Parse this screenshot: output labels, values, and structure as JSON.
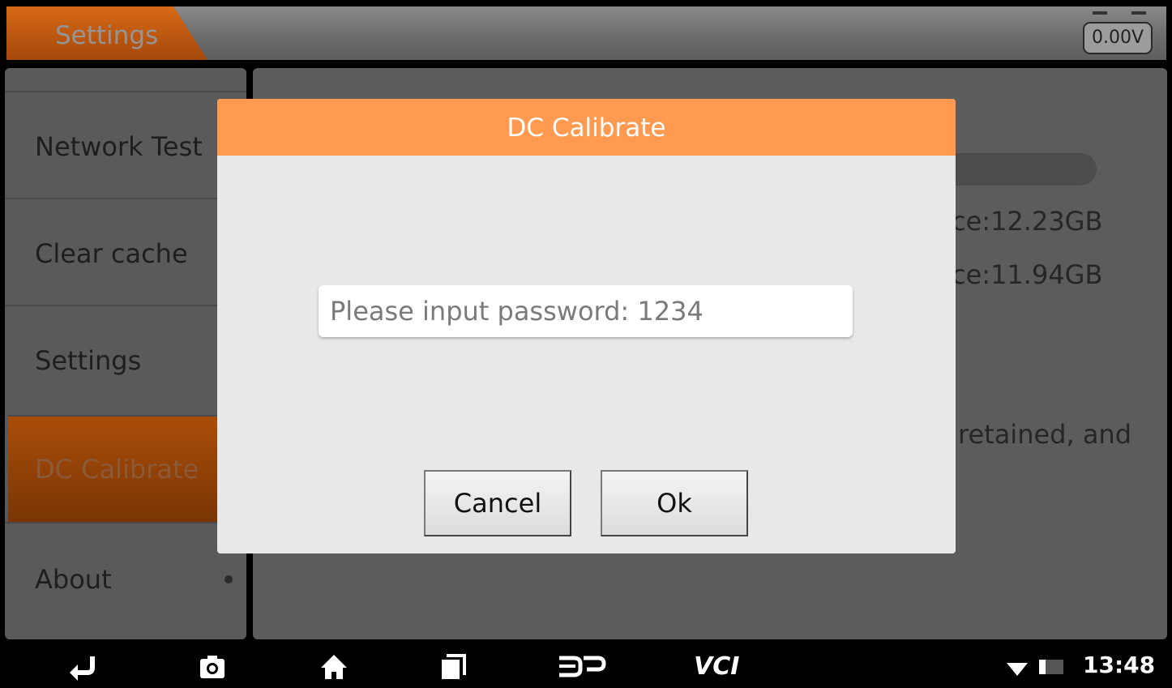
{
  "header": {
    "title": "Settings",
    "voltage": "0.00V"
  },
  "sidebar": {
    "items": [
      {
        "label": "Network Test"
      },
      {
        "label": "Clear cache"
      },
      {
        "label": "Settings"
      },
      {
        "label": "DC Calibrate",
        "active": true
      },
      {
        "label": "About"
      }
    ]
  },
  "background_panel": {
    "line1": "ce:12.23GB",
    "line2": "ce:11.94GB",
    "line3": "retained, and"
  },
  "dialog": {
    "title": "DC Calibrate",
    "password_placeholder": "Please input password: 1234",
    "password_value": "",
    "cancel_label": "Cancel",
    "ok_label": "Ok"
  },
  "navbar": {
    "icons": [
      "back-icon",
      "camera-icon",
      "home-icon",
      "recents-icon",
      "dp-icon",
      "vci-icon"
    ],
    "dp_label": "DP",
    "vci_label": "VCI",
    "time": "13:48"
  },
  "colors": {
    "accent_orange": "#ff9a50",
    "active_item": "#aa4d09",
    "dialog_bg": "#e8e8e8"
  }
}
